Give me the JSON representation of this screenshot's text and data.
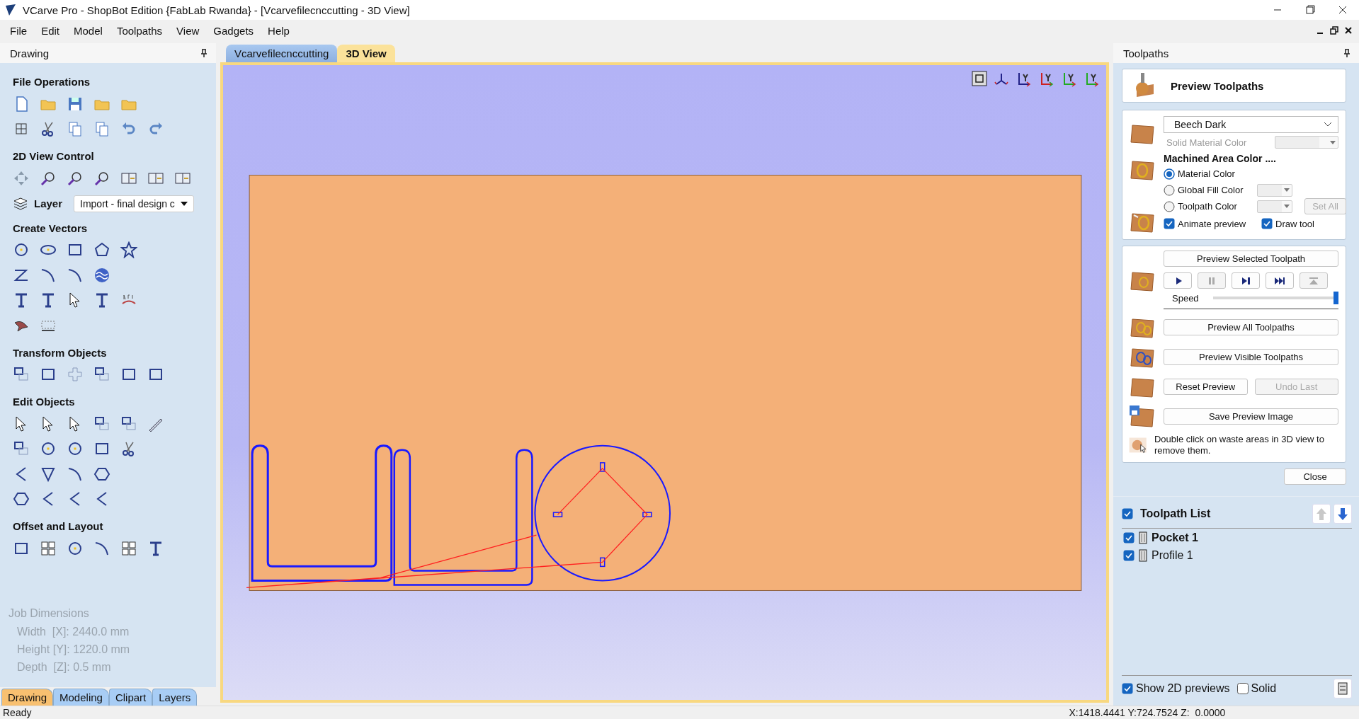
{
  "window": {
    "title": "VCarve Pro - ShopBot Edition {FabLab Rwanda} - [Vcarvefilecnccutting - 3D View]"
  },
  "menu": [
    "File",
    "Edit",
    "Model",
    "Toolpaths",
    "View",
    "Gadgets",
    "Help"
  ],
  "drawing_panel": {
    "title": "Drawing",
    "sections": [
      {
        "title": "File Operations"
      },
      {
        "title": "2D View Control",
        "layer": {
          "label": "Layer",
          "value": "Import - final design c"
        }
      },
      {
        "title": "Create Vectors"
      },
      {
        "title": "Transform Objects"
      },
      {
        "title": "Edit Objects"
      },
      {
        "title": "Offset and Layout"
      }
    ],
    "job_dimensions": {
      "title": "Job Dimensions",
      "lines": [
        "Width  [X]: 2440.0 mm",
        "Height [Y]: 1220.0 mm",
        "Depth  [Z]: 0.5 mm"
      ]
    },
    "tabs": [
      {
        "label": "Drawing",
        "selected": true
      },
      {
        "label": "Modeling",
        "selected": false
      },
      {
        "label": "Clipart",
        "selected": false
      },
      {
        "label": "Layers",
        "selected": false
      }
    ]
  },
  "document_tabs": [
    {
      "label": "Vcarvefilecnccutting",
      "selected": false
    },
    {
      "label": "3D View",
      "selected": true
    }
  ],
  "toolpaths_panel": {
    "title": "Toolpaths",
    "heading": "Preview Toolpaths",
    "material": {
      "value": "Beech Dark",
      "solid_color_label": "Solid Material Color"
    },
    "machined": {
      "title": "Machined Area Color ....",
      "options": [
        {
          "label": "Material Color",
          "selected": true,
          "swatch": false
        },
        {
          "label": "Global Fill Color",
          "selected": false,
          "swatch": true
        },
        {
          "label": "Toolpath Color",
          "selected": false,
          "swatch": true
        }
      ],
      "set_all": {
        "label": "Set All",
        "disabled": true
      }
    },
    "animate_preview": {
      "label": "Animate preview",
      "checked": true
    },
    "draw_tool": {
      "label": "Draw tool",
      "checked": true
    },
    "preview_selected": "Preview Selected Toolpath",
    "playback": [
      {
        "kind": "play",
        "disabled": false
      },
      {
        "kind": "pause",
        "disabled": true
      },
      {
        "kind": "step",
        "disabled": false
      },
      {
        "kind": "end",
        "disabled": false
      },
      {
        "kind": "rewind",
        "disabled": true
      }
    ],
    "speed": {
      "label": "Speed",
      "level": 1.0
    },
    "preview_all": "Preview All Toolpaths",
    "preview_visible": "Preview Visible Toolpaths",
    "reset": {
      "label": "Reset Preview",
      "disabled": false
    },
    "undo": {
      "label": "Undo Last",
      "disabled": true
    },
    "save_image": "Save Preview Image",
    "hint": "Double click on waste areas in 3D view to remove them.",
    "close": "Close",
    "toolpath_list": {
      "title": "Toolpath List",
      "checked": true,
      "move_buttons": [
        {
          "kind": "up",
          "disabled": true
        },
        {
          "kind": "down",
          "disabled": false
        }
      ],
      "items": [
        {
          "name": "Pocket 1",
          "checked": true,
          "selected": true
        },
        {
          "name": "Profile 1",
          "checked": true,
          "selected": false
        }
      ]
    },
    "show_2d_previews": {
      "label": "Show 2D previews",
      "checked": true
    },
    "solid": {
      "label": "Solid",
      "checked": false
    }
  },
  "status_bar": {
    "text": "Ready",
    "coordinates": "X:1418.4441 Y:724.7524 Z:  0.0000"
  }
}
